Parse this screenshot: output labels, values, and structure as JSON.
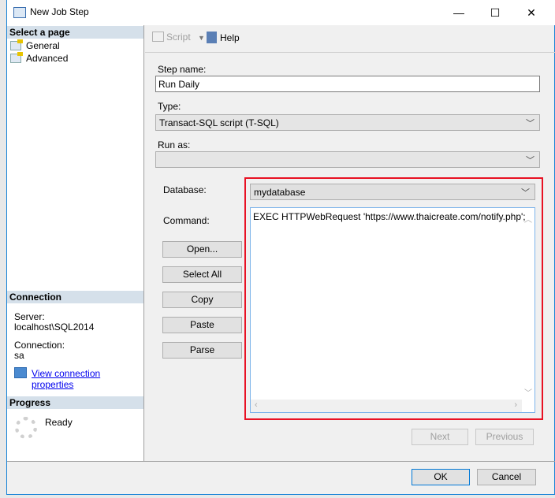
{
  "window": {
    "title": "New Job Step",
    "minimize": "—",
    "maximize": "☐",
    "close": "✕"
  },
  "left": {
    "select_page": "Select a page",
    "pages": [
      {
        "label": "General"
      },
      {
        "label": "Advanced"
      }
    ],
    "connection_header": "Connection",
    "server_label": "Server:",
    "server_value": "localhost\\SQL2014",
    "connection_label": "Connection:",
    "connection_value": "sa",
    "view_props": "View connection properties",
    "progress_header": "Progress",
    "progress_status": "Ready"
  },
  "toolbar": {
    "script": "Script",
    "help": "Help"
  },
  "form": {
    "step_name_label": "Step name:",
    "step_name_value": "Run Daily",
    "type_label": "Type:",
    "type_value": "Transact-SQL script (T-SQL)",
    "run_as_label": "Run as:",
    "run_as_value": "",
    "database_label": "Database:",
    "database_value": "mydatabase",
    "command_label": "Command:",
    "command_value": "EXEC HTTPWebRequest 'https://www.thaicreate.com/notify.php';",
    "buttons": {
      "open": "Open...",
      "select_all": "Select All",
      "copy": "Copy",
      "paste": "Paste",
      "parse": "Parse"
    },
    "next": "Next",
    "previous": "Previous"
  },
  "footer": {
    "ok": "OK",
    "cancel": "Cancel"
  }
}
